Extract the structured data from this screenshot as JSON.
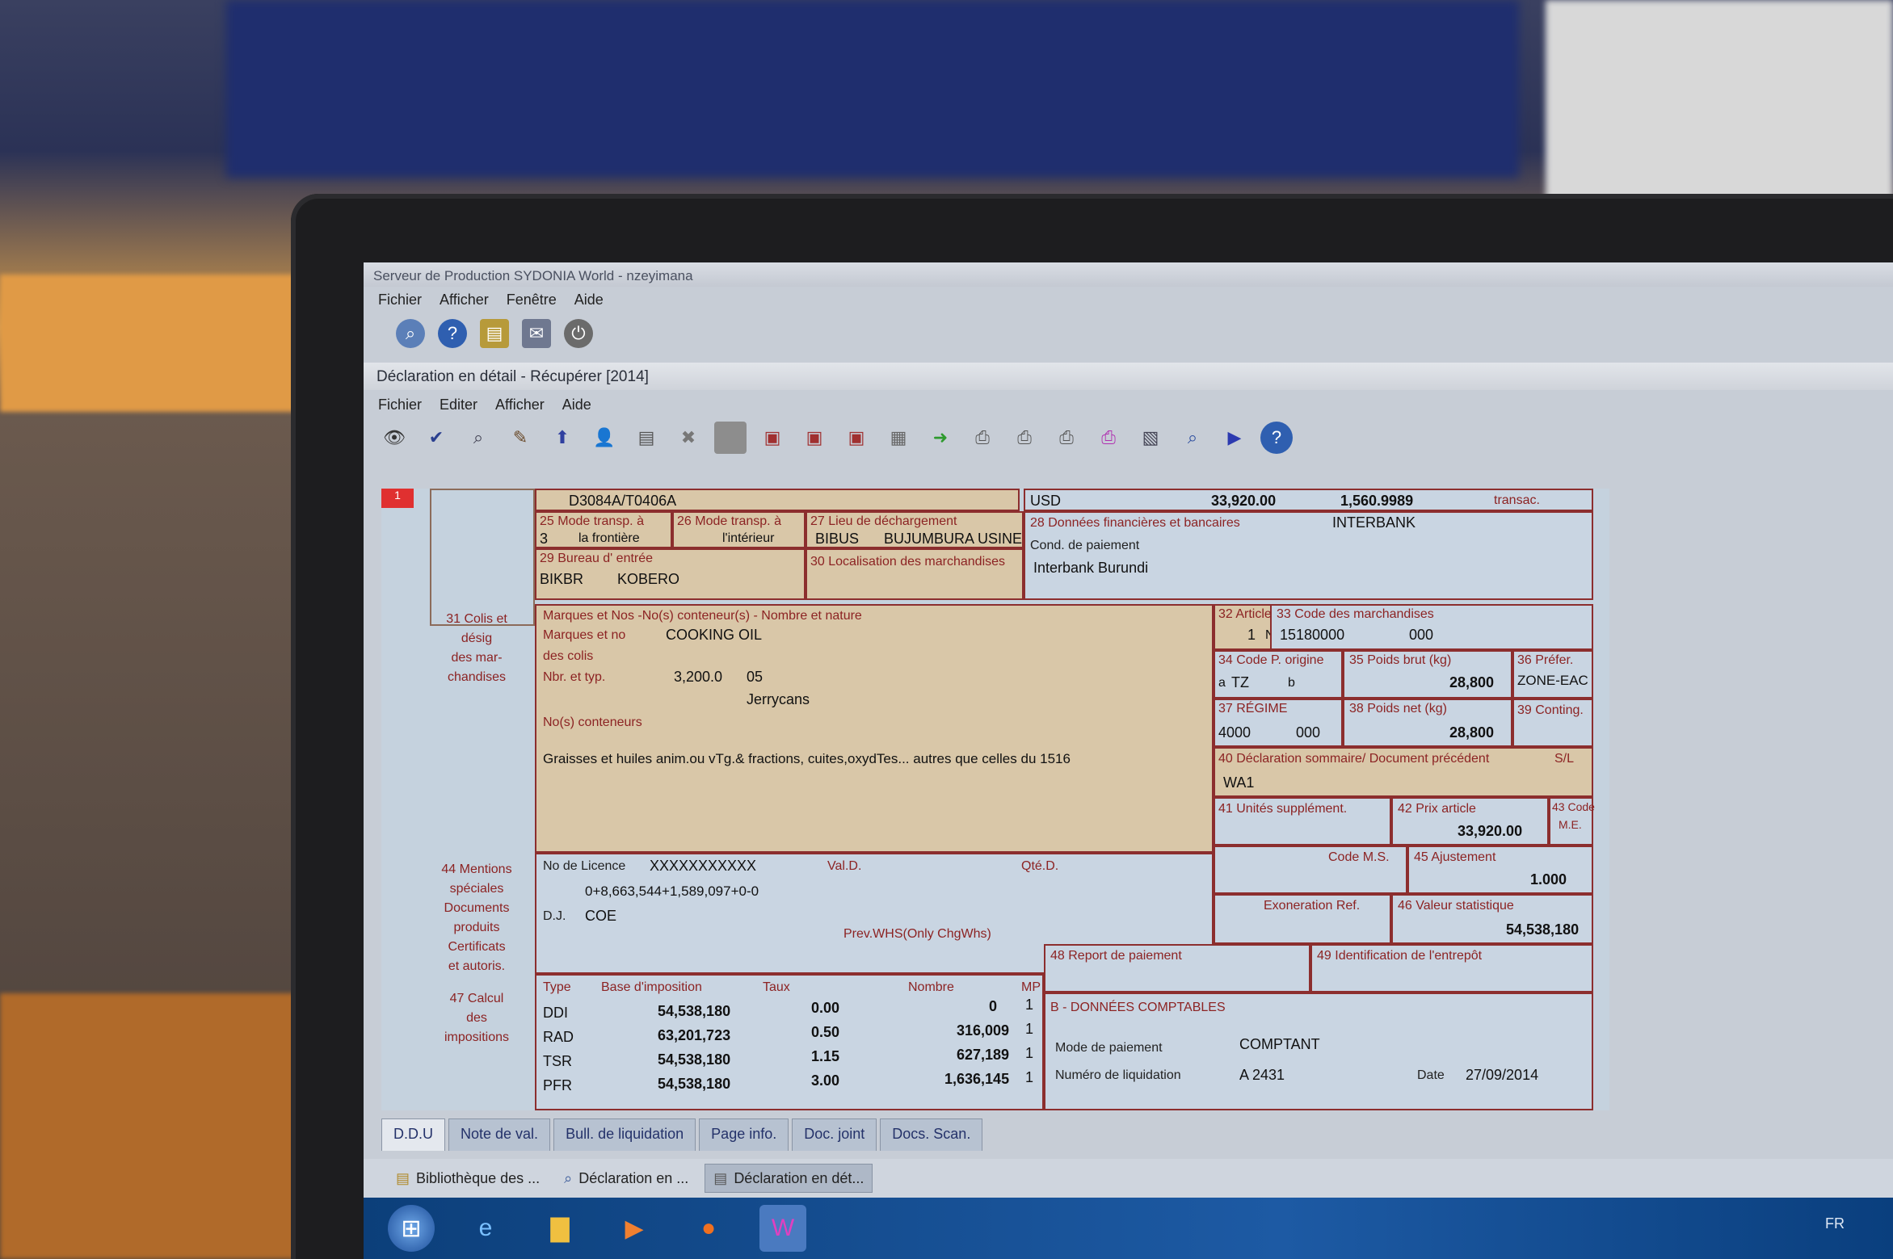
{
  "outer_window": {
    "title": "Serveur de Production SYDONIA World - nzeyimana",
    "menu": [
      "Fichier",
      "Afficher",
      "Fenêtre",
      "Aide"
    ]
  },
  "inner_window": {
    "title": "Déclaration en détail - Récupérer [2014]",
    "menu": [
      "Fichier",
      "Editer",
      "Afficher",
      "Aide"
    ]
  },
  "header": {
    "reference": "D3084A/T0406A",
    "currency": "USD",
    "amount": "33,920.00",
    "rate": "1,560.9989",
    "transac_label": "transac."
  },
  "transport": {
    "box25_label": "25 Mode transp. à",
    "box25_sub": "la frontière",
    "box25_value": "3",
    "box26_label": "26 Mode transp. à",
    "box26_sub": "l'intérieur",
    "box27_label": "27 Lieu de déchargement",
    "box27_code": "BIBUS",
    "box27_value": "BUJUMBURA USINE",
    "box29_label": "29 Bureau d' entrée",
    "box29_code": "BIKBR",
    "box29_value": "KOBERO",
    "box30_label": "30 Localisation des marchandises"
  },
  "finance": {
    "box28_label": "28 Données financières et bancaires",
    "bank": "INTERBANK",
    "cond_label": "Cond. de paiement",
    "bank_name": "Interbank Burundi"
  },
  "goods": {
    "side31": [
      "31 Colis et",
      "désig",
      "des mar-",
      "chandises"
    ],
    "marks_label": "Marques et Nos -No(s) conteneur(s) - Nombre et nature",
    "marks_line1": "Marques et no",
    "marks_line2": "des colis",
    "marks_value": "COOKING OIL",
    "nbr_label": "Nbr. et typ.",
    "nbr_value": "3,200.0",
    "nbr_code": "05",
    "nbr_type": "Jerrycans",
    "containers_label": "No(s) conteneurs",
    "description": "Graisses et huiles anim.ou vTg.& fractions, cuites,oxydTes... autres que celles du 1516"
  },
  "article": {
    "box32_label": "32 Article",
    "article_no": "1",
    "no_label": "No.",
    "box33_label": "33 Code des marchandises",
    "hs_code": "15180000",
    "hs_ext": "000",
    "box34_label": "34 Code P. origine",
    "origin": "TZ",
    "a_label": "a",
    "b_label": "b",
    "box35_label": "35 Poids brut (kg)",
    "gross": "28,800",
    "box36_label": "36 Préfer.",
    "pref": "ZONE-EAC",
    "box37_label": "37 RÉGIME",
    "regime": "4000",
    "regime_ext": "000",
    "box38_label": "38 Poids net (kg)",
    "net": "28,800",
    "box39_label": "39 Conting.",
    "box40_label": "40 Déclaration sommaire/ Document précédent",
    "sl_label": "S/L",
    "prev_doc": "WA1",
    "box41_label": "41 Unités supplément.",
    "box42_label": "42 Prix article",
    "price": "33,920.00",
    "box43_label": "43 Code",
    "me_label": "M.E.",
    "codems_label": "Code M.S.",
    "box45_label": "45 Ajustement",
    "adjust": "1.000",
    "exo_label": "Exoneration Ref.",
    "box46_label": "46 Valeur statistique",
    "stat_value": "54,538,180"
  },
  "mentions": {
    "side44": [
      "44 Mentions",
      "spéciales",
      "Documents",
      "produits",
      "Certificats",
      "et autoris."
    ],
    "licence_label": "No de Licence",
    "licence_value": "XXXXXXXXXXX",
    "vald_label": "Val.D.",
    "qted_label": "Qté.D.",
    "formula": "0+8,663,544+1,589,097+0-0",
    "dj_label": "D.J.",
    "dj_value": "COE",
    "prev_whs": "Prev.WHS(Only ChgWhs)"
  },
  "taxes": {
    "side47": [
      "47 Calcul",
      "des",
      "impositions"
    ],
    "headers": [
      "Type",
      "Base d'imposition",
      "Taux",
      "Nombre",
      "MP"
    ],
    "rows": [
      {
        "type": "DDI",
        "base": "54,538,180",
        "rate": "0.00",
        "amount": "0",
        "mp": "1"
      },
      {
        "type": "RAD",
        "base": "63,201,723",
        "rate": "0.50",
        "amount": "316,009",
        "mp": "1"
      },
      {
        "type": "TSR",
        "base": "54,538,180",
        "rate": "1.15",
        "amount": "627,189",
        "mp": "1"
      },
      {
        "type": "PFR",
        "base": "54,538,180",
        "rate": "3.00",
        "amount": "1,636,145",
        "mp": "1"
      }
    ]
  },
  "accounting": {
    "box48_label": "48 Report de paiement",
    "box49_label": "49 Identification de l'entrepôt",
    "section_b": "B - DONNÉES COMPTABLES",
    "pay_mode_label": "Mode de paiement",
    "pay_mode": "COMPTANT",
    "liq_label": "Numéro de liquidation",
    "liq_value": "A 2431",
    "date_label": "Date",
    "date_value": "27/09/2014"
  },
  "tabs": [
    "D.D.U",
    "Note de val.",
    "Bull. de liquidation",
    "Page info.",
    "Doc. joint",
    "Docs. Scan."
  ],
  "taskbar_upper": [
    "Bibliothèque des ...",
    "Déclaration en ...",
    "Déclaration en dét..."
  ],
  "lang": "FR"
}
